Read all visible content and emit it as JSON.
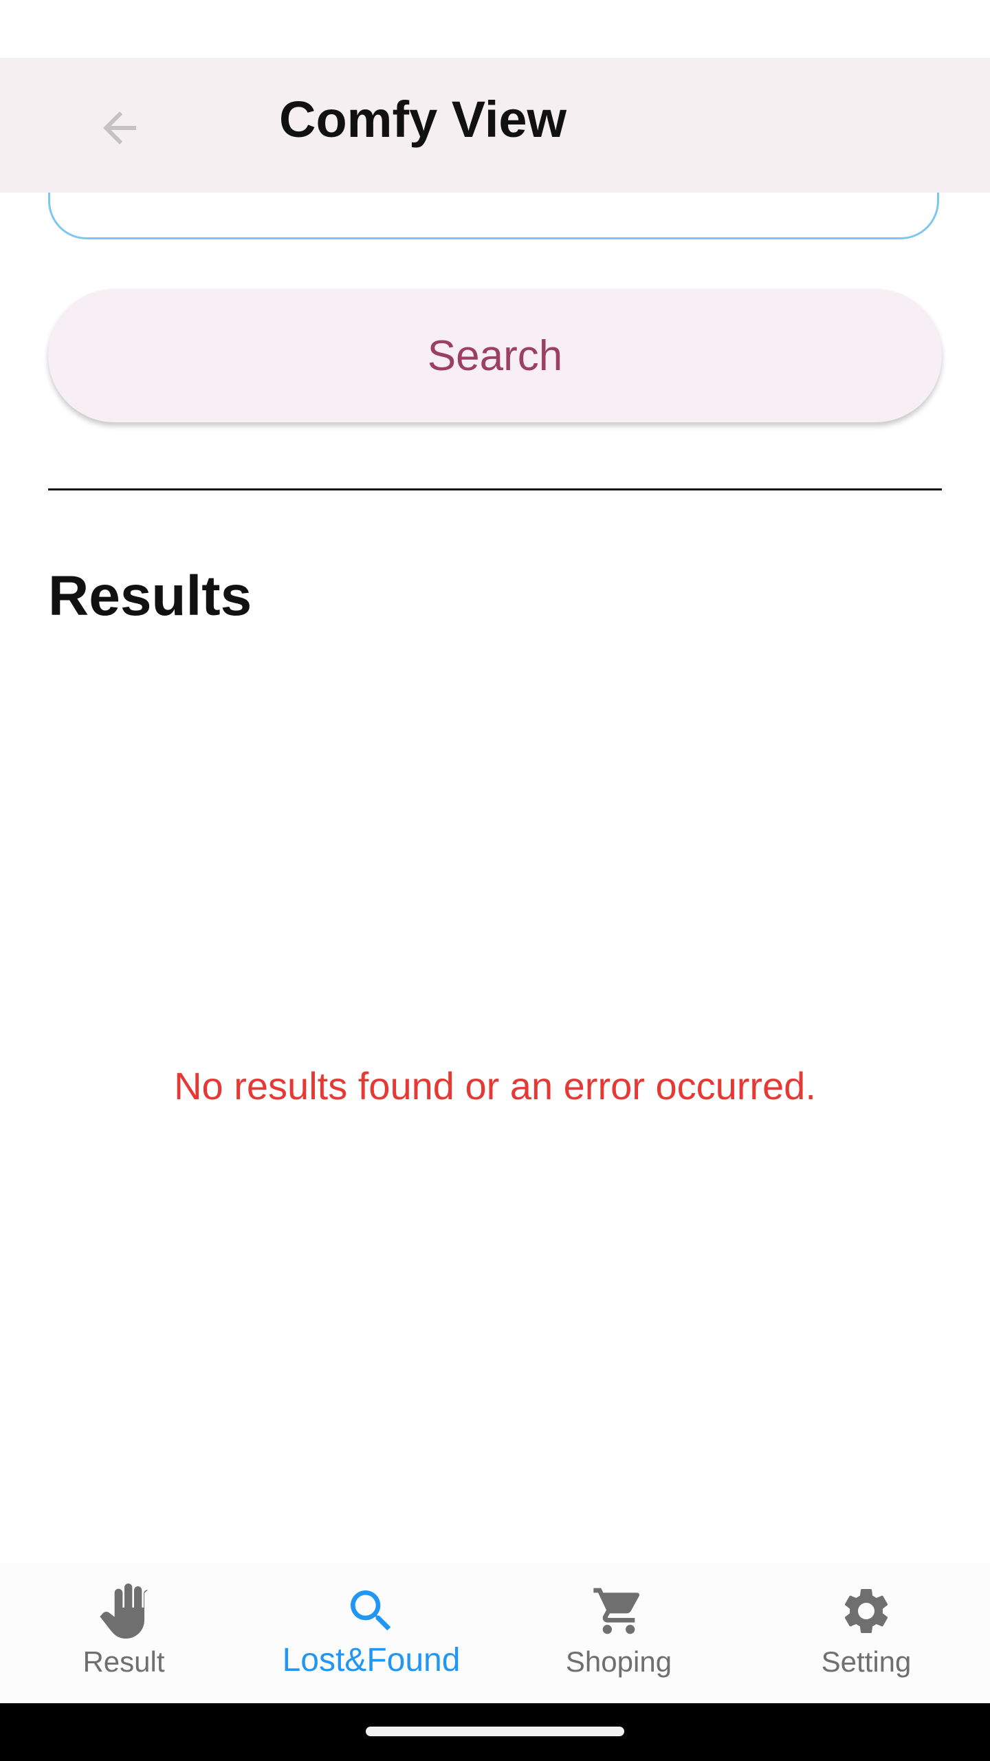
{
  "app_bar": {
    "title": "Comfy View",
    "back_icon": "arrow-back-icon"
  },
  "search": {
    "button_label": "Search"
  },
  "results": {
    "heading": "Results",
    "empty_message": "No results found or an error occurred."
  },
  "bottom_nav": {
    "items": [
      {
        "label": "Result",
        "icon": "hand-icon",
        "active": false
      },
      {
        "label": "Lost&Found",
        "icon": "search-icon",
        "active": true
      },
      {
        "label": "Shoping",
        "icon": "cart-icon",
        "active": false
      },
      {
        "label": "Setting",
        "icon": "gear-icon",
        "active": false
      }
    ]
  },
  "colors": {
    "app_bar_bg": "#f5eff2",
    "button_text": "#9b3f63",
    "error": "#e53935",
    "active_nav": "#2196f3",
    "inactive_nav": "#6f6f6f",
    "field_border": "#7fc6ee"
  }
}
